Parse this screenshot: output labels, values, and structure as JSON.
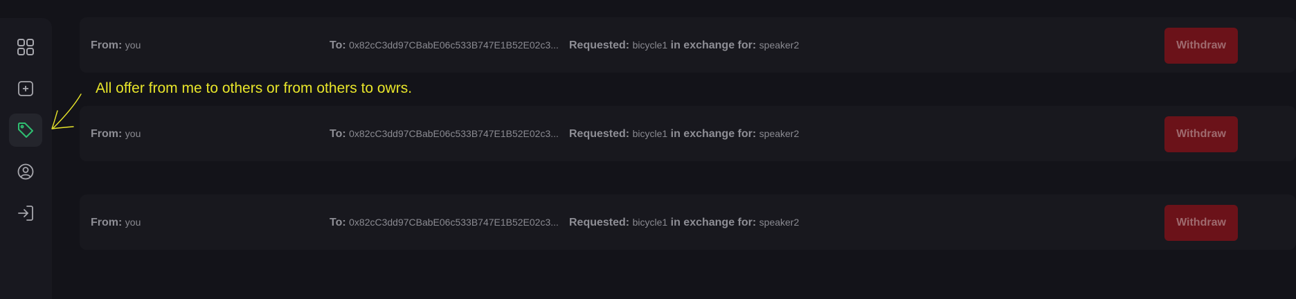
{
  "sidebar": {
    "items": [
      {
        "name": "dashboard",
        "icon": "grid-icon",
        "active": false
      },
      {
        "name": "create",
        "icon": "plus-square-icon",
        "active": false
      },
      {
        "name": "offers",
        "icon": "tag-icon",
        "active": true
      },
      {
        "name": "profile",
        "icon": "user-circle-icon",
        "active": false
      },
      {
        "name": "logout",
        "icon": "log-in-icon",
        "active": false
      }
    ],
    "active_color": "#2fbf71",
    "icon_color": "#a7a7ad"
  },
  "annotation": {
    "text": "All offer from me to others or from others to owrs.",
    "color": "#e9e62a"
  },
  "offers": [
    {
      "from_label": "From:",
      "from_value": "you",
      "to_label": "To:",
      "to_value": "0x82cC3dd97CBabE06c533B747E1B52E02c3...",
      "requested_label": "Requested:",
      "requested_value": "bicycle1",
      "exchange_label": "in exchange for:",
      "exchange_value": "speaker2",
      "action_label": "Withdraw"
    },
    {
      "from_label": "From:",
      "from_value": "you",
      "to_label": "To:",
      "to_value": "0x82cC3dd97CBabE06c533B747E1B52E02c3...",
      "requested_label": "Requested:",
      "requested_value": "bicycle1",
      "exchange_label": "in exchange for:",
      "exchange_value": "speaker2",
      "action_label": "Withdraw"
    },
    {
      "from_label": "From:",
      "from_value": "you",
      "to_label": "To:",
      "to_value": "0x82cC3dd97CBabE06c533B747E1B52E02c3...",
      "requested_label": "Requested:",
      "requested_value": "bicycle1",
      "exchange_label": "in exchange for:",
      "exchange_value": "speaker2",
      "action_label": "Withdraw"
    }
  ],
  "colors": {
    "background": "#131319",
    "card": "#18181e",
    "withdraw": "#6b1219"
  }
}
